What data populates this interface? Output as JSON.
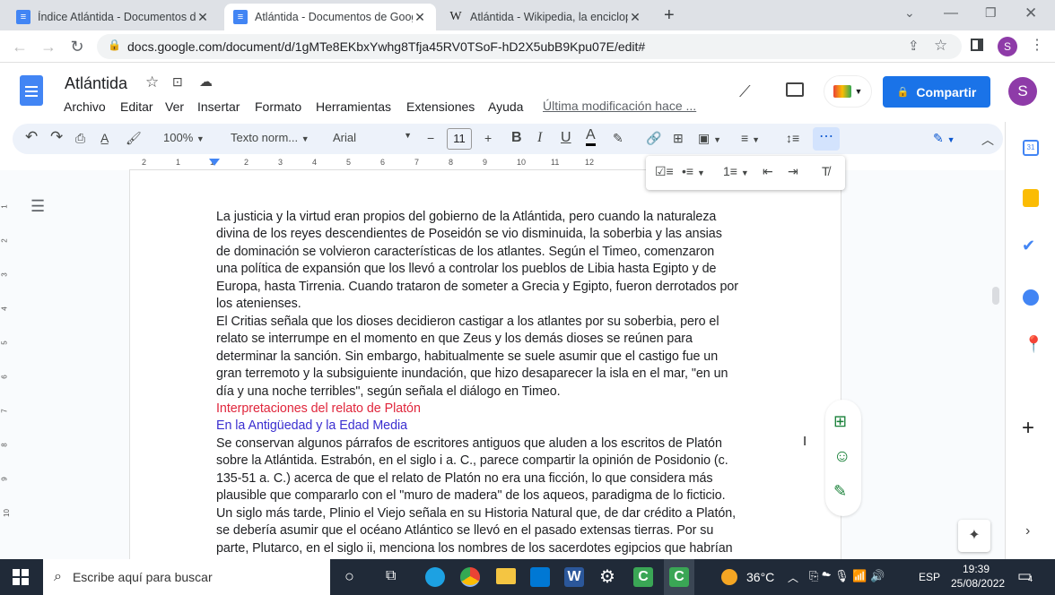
{
  "browser": {
    "tabs": [
      {
        "title": "Índice Atlántida - Documentos d",
        "icon": "docs-icon",
        "active": false
      },
      {
        "title": "Atlántida - Documentos de Goog",
        "icon": "docs-icon",
        "active": true
      },
      {
        "title": "Atlántida - Wikipedia, la enciclop",
        "icon": "wikipedia-icon",
        "active": false
      }
    ],
    "wiki_glyph": "W",
    "url": "docs.google.com/document/d/1gMTe8EKbxYwhg8Tfja45RV0TSoF-hD2X5ubB9Kpu07E/edit#",
    "profile_initial": "S"
  },
  "docs": {
    "title": "Atlántida",
    "menu": [
      "Archivo",
      "Editar",
      "Ver",
      "Insertar",
      "Formato",
      "Herramientas",
      "Extensiones",
      "Ayuda"
    ],
    "last_edit": "Última modificación hace ...",
    "share_label": "Compartir",
    "avatar": "S"
  },
  "toolbar": {
    "zoom": "100%",
    "style": "Texto norm...",
    "font": "Arial",
    "font_size": "11"
  },
  "ruler": [
    "2",
    "1",
    "1",
    "2",
    "3",
    "4",
    "5",
    "6",
    "7",
    "8",
    "9",
    "10",
    "11",
    "12"
  ],
  "vruler": [
    "1",
    "2",
    "3",
    "4",
    "5",
    "6",
    "7",
    "8",
    "9",
    "10"
  ],
  "document": {
    "lines": [
      {
        "text": "La justicia y la virtud eran propios del gobierno de la Atlántida, pero cuando la naturaleza",
        "color": "#202124"
      },
      {
        "text": "divina de los reyes descendientes de Poseidón se vio disminuida, la soberbia y las ansias",
        "color": "#202124"
      },
      {
        "text": "de dominación se volvieron características de los atlantes. Según el Timeo, comenzaron",
        "color": "#202124"
      },
      {
        "text": "una política de expansión que los llevó a controlar los pueblos de Libia hasta Egipto y de",
        "color": "#202124"
      },
      {
        "text": "Europa, hasta Tirrenia. Cuando trataron de someter a Grecia y Egipto, fueron derrotados por",
        "color": "#202124"
      },
      {
        "text": "los atenienses.",
        "color": "#202124"
      },
      {
        "text": "El Critias señala que los dioses decidieron castigar a los atlantes por su soberbia, pero el",
        "color": "#202124"
      },
      {
        "text": "relato se interrumpe en el momento en que Zeus y los demás dioses se reúnen para",
        "color": "#202124"
      },
      {
        "text": "determinar la sanción. Sin embargo, habitualmente se suele asumir que el castigo fue un",
        "color": "#202124"
      },
      {
        "text": "gran terremoto y la subsiguiente inundación, que hizo desaparecer la isla en el mar, \"en un",
        "color": "#202124"
      },
      {
        "text": "día y una noche terribles\", según señala el diálogo en Timeo.",
        "color": "#202124"
      },
      {
        "text": "Interpretaciones del relato de Platón",
        "color": "#e0263c"
      },
      {
        "text": "En la Antigüedad y la Edad Media",
        "color": "#3b2fd0"
      },
      {
        "text": "Se conservan algunos párrafos de escritores antiguos que aluden a los escritos de Platón",
        "color": "#202124"
      },
      {
        "text": "sobre la Atlántida. Estrabón, en el siglo i a. C., parece compartir la opinión de Posidonio (c.",
        "color": "#202124"
      },
      {
        "text": "135-51 a. C.) acerca de que el relato de Platón no era una ficción, lo que considera más",
        "color": "#202124"
      },
      {
        "text": "plausible que compararlo con el \"muro de madera\" de los aqueos, paradigma de lo ficticio.",
        "color": "#202124"
      },
      {
        "text": "Un siglo más tarde, Plinio el Viejo señala en su Historia Natural que, de dar crédito a Platón,",
        "color": "#202124"
      },
      {
        "text": "se debería asumir que el océano Atlántico se llevó en el pasado extensas tierras. Por su",
        "color": "#202124"
      },
      {
        "text": "parte, Plutarco, en el siglo ii, menciona los nombres de los sacerdotes egipcios que habrían",
        "color": "#202124"
      }
    ]
  },
  "taskbar": {
    "search_placeholder": "Escribe aquí para buscar",
    "temperature": "36°C",
    "language": "ESP",
    "time": "19:39",
    "date": "25/08/2022",
    "notifications": "4"
  }
}
